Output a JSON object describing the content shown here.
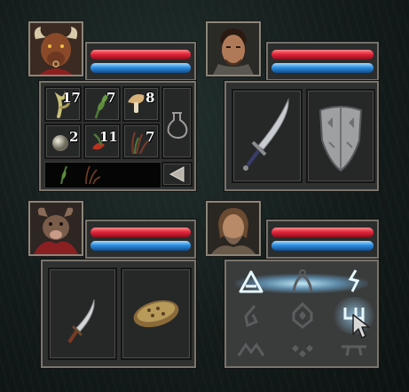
{
  "party": [
    {
      "id": "minotaur",
      "portrait_icon": "minotaur-portrait-icon",
      "health_percent": 100,
      "mana_percent": 100,
      "inventory": [
        {
          "icon": "root-icon",
          "count": "17"
        },
        {
          "icon": "herb-sprig-icon",
          "count": "7"
        },
        {
          "icon": "mushroom-icon",
          "count": "8"
        },
        {
          "icon": "pearl-icon",
          "count": "2"
        },
        {
          "icon": "red-herb-icon",
          "count": "11"
        },
        {
          "icon": "grass-tuft-icon",
          "count": "7"
        }
      ],
      "side_slot_icon": "potion-flask-icon",
      "quickbar_icons": [
        "herb-sprig-icon",
        "dry-root-icon"
      ]
    },
    {
      "id": "warrior",
      "portrait_icon": "warrior-portrait-icon",
      "health_percent": 100,
      "mana_percent": 100,
      "equipment": [
        "sword-icon",
        "shield-icon"
      ]
    },
    {
      "id": "ratling",
      "portrait_icon": "ratling-portrait-icon",
      "health_percent": 100,
      "mana_percent": 100,
      "equipment": [
        "dagger-icon",
        "bread-icon"
      ]
    },
    {
      "id": "mage",
      "portrait_icon": "mage-portrait-icon",
      "health_percent": 100,
      "mana_percent": 100,
      "runes": [
        "rune-1-icon",
        "rune-2-icon",
        "rune-3-icon",
        "rune-4-icon",
        "rune-5-icon",
        "rune-6-icon",
        "rune-7-icon",
        "rune-8-icon",
        "rune-9-icon"
      ],
      "active_runes": [
        "rune-1-icon",
        "rune-3-icon",
        "rune-6-icon"
      ]
    }
  ],
  "colors": {
    "health": "#e3253b",
    "mana": "#2d8ee0",
    "rune_glow": "#9fe0ff",
    "frame": "#7a746b"
  },
  "cursor_icon": "mouse-pointer-icon"
}
